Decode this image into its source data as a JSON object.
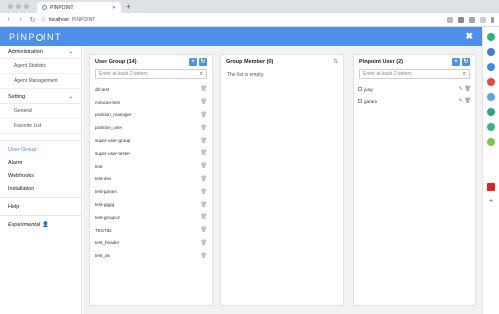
{
  "browser": {
    "tab_title": "PINPOINT",
    "url_host": "localhost",
    "url_path": "PINPOINT"
  },
  "app": {
    "logo_prefix": "PINP",
    "logo_suffix": "INT",
    "close_glyph": "✖"
  },
  "sidebar": {
    "administration": {
      "label": "Administration",
      "items": [
        "Agent Statistic",
        "Agent Management"
      ]
    },
    "setting": {
      "label": "Setting",
      "items": [
        "General",
        "Favorite List"
      ]
    },
    "user_group": "User Group",
    "alarm": "Alarm",
    "webhooks": "Webhooks",
    "installation": "Installation",
    "help": "Help",
    "experimental": "Experimental"
  },
  "user_group_panel": {
    "title": "User Group (14)",
    "search_placeholder": "Enter at least 2 letters",
    "groups": [
      "db-test",
      "minwoo-test",
      "position_manager",
      "position_user",
      "super-user-group",
      "super-user-tester",
      "test",
      "test-dev",
      "test-garam",
      "test-gggg",
      "test-group-2",
      "TESTds",
      "test_header",
      "test_as"
    ]
  },
  "group_member_panel": {
    "title": "Group Member (0)",
    "empty_text": "The list is empty."
  },
  "pinpoint_user_panel": {
    "title": "Pinpoint User (2)",
    "search_placeholder": "Enter at least 2 letters",
    "users": [
      "jung",
      "garam"
    ]
  }
}
